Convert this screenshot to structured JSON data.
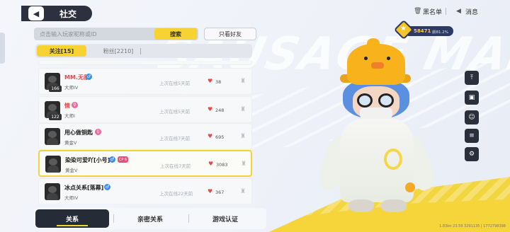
{
  "header": {
    "back_icon": "chevron-left-icon",
    "title": "社交",
    "blacklist_label": "黑名单",
    "messages_label": "消息"
  },
  "search": {
    "placeholder": "点击输入玩家昵称或ID",
    "button_label": "搜索",
    "friends_only_label": "只看好友"
  },
  "tabs": [
    {
      "label": "关注[15]",
      "active": true
    },
    {
      "label": "粉丝[2210]",
      "active": false
    }
  ],
  "friends": [
    {
      "name": "MM.无敌",
      "level": "166",
      "rank": "大师IV",
      "gender": "male",
      "last_online": "上次在线5天前",
      "hearts": "38",
      "name_color": "#e24b4b"
    },
    {
      "name": "情",
      "level": "122",
      "rank": "大师I",
      "gender": "female",
      "last_online": "上次在线5天前",
      "hearts": "248",
      "name_color": "#e24b4b"
    },
    {
      "name": "用心做铜匙",
      "level": "",
      "rank": "黄金V",
      "gender": "female",
      "last_online": "上次在线7天前",
      "hearts": "695",
      "name_color": "#222222"
    },
    {
      "name": "染染可爱吖[小号]",
      "level": "",
      "rank": "黄金V",
      "gender": "male",
      "badge": "CP 6",
      "last_online": "上次在线7天前",
      "hearts": "3083",
      "name_color": "#222222",
      "selected": true
    },
    {
      "name": "冰点关系[落幕]",
      "level": "",
      "rank": "大师IV",
      "gender": "male",
      "last_online": "上次在线22天前",
      "hearts": "367",
      "name_color": "#222222"
    }
  ],
  "bottom_tabs": [
    {
      "label": "关系",
      "active": true
    },
    {
      "label": "亲密关系",
      "active": false
    },
    {
      "label": "游戏认证",
      "active": false
    }
  ],
  "player": {
    "score": "58471",
    "percentile": "前81.2%"
  },
  "side_buttons": [
    "upload-icon",
    "gift-icon",
    "chat-icon",
    "note-icon",
    "settings-icon"
  ],
  "footer": "1.83bn 23.59 3291135 | 1772798398",
  "watermark": "SAUSAGE MAN",
  "colors": {
    "accent": "#f7d233",
    "dark": "#262b38",
    "heart": "#e24b4b"
  }
}
